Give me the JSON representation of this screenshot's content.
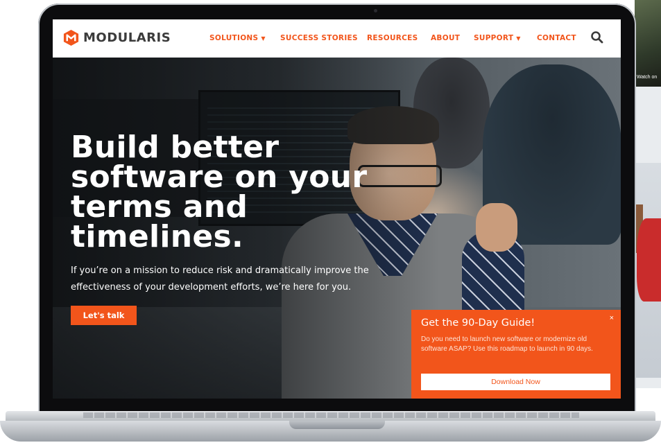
{
  "brand": {
    "name": "MODULARIS",
    "color": "#f2551b"
  },
  "nav": {
    "items": [
      {
        "label": "SOLUTIONS",
        "has_caret": true
      },
      {
        "label": "SUCCESS STORIES"
      },
      {
        "label": "RESOURCES"
      },
      {
        "label": "ABOUT"
      },
      {
        "label": "SUPPORT",
        "has_caret": true
      },
      {
        "label": "CONTACT"
      }
    ],
    "caret": "▼",
    "search_icon": "search-icon"
  },
  "hero": {
    "headline_lines": [
      "Build better",
      "software on your",
      "terms and",
      "timelines."
    ],
    "subtext": "If you’re on a mission to reduce risk and dramatically improve the effectiveness of your development efforts, we’re here for you.",
    "cta_label": "Let's talk"
  },
  "popup": {
    "title": "Get the 90-Day Guide!",
    "body": "Do you need to launch new software or modernize old software ASAP? Use this roadmap to launch in 90 days.",
    "button_label": "Download Now",
    "close": "×"
  },
  "side_thumbnail": {
    "watch_label": "Watch on"
  }
}
